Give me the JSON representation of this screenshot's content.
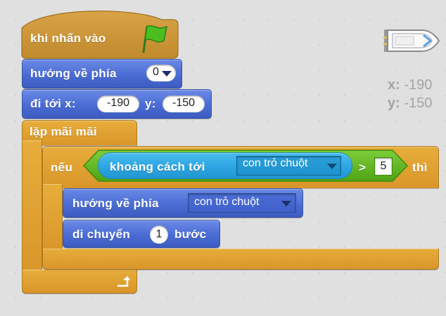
{
  "script": {
    "hat": {
      "label": "khi nhấn vào",
      "icon": "green-flag-icon",
      "color": "#d09a35"
    },
    "point_direction": {
      "label": "hướng về phía",
      "value": "0"
    },
    "goto_xy": {
      "label_go": "đi tới x:",
      "x_value": "-190",
      "label_y": "y:",
      "y_value": "-150"
    },
    "forever": {
      "label": "lặp mãi mãi",
      "color": "#e1a234"
    },
    "if_block": {
      "label_if": "nếu",
      "label_then": "thì",
      "condition": {
        "sensing_label": "khoảng cách tới",
        "target": "con trỏ chuột",
        "operator": ">",
        "compare_value": "5"
      }
    },
    "point_towards": {
      "label": "hướng về phía",
      "target": "con trỏ chuột"
    },
    "move": {
      "label_before": "di chuyển",
      "steps": "1",
      "label_after": "bước"
    }
  },
  "sprite": {
    "name_icon": "boat-sprite-icon",
    "x_label": "x:",
    "x_value": "-190",
    "y_label": "y:",
    "y_value": "-150"
  },
  "colors": {
    "motion": "#4a6cd4",
    "control": "#e1a234",
    "sensing": "#2ca5e2",
    "operators": "#5cb712"
  }
}
